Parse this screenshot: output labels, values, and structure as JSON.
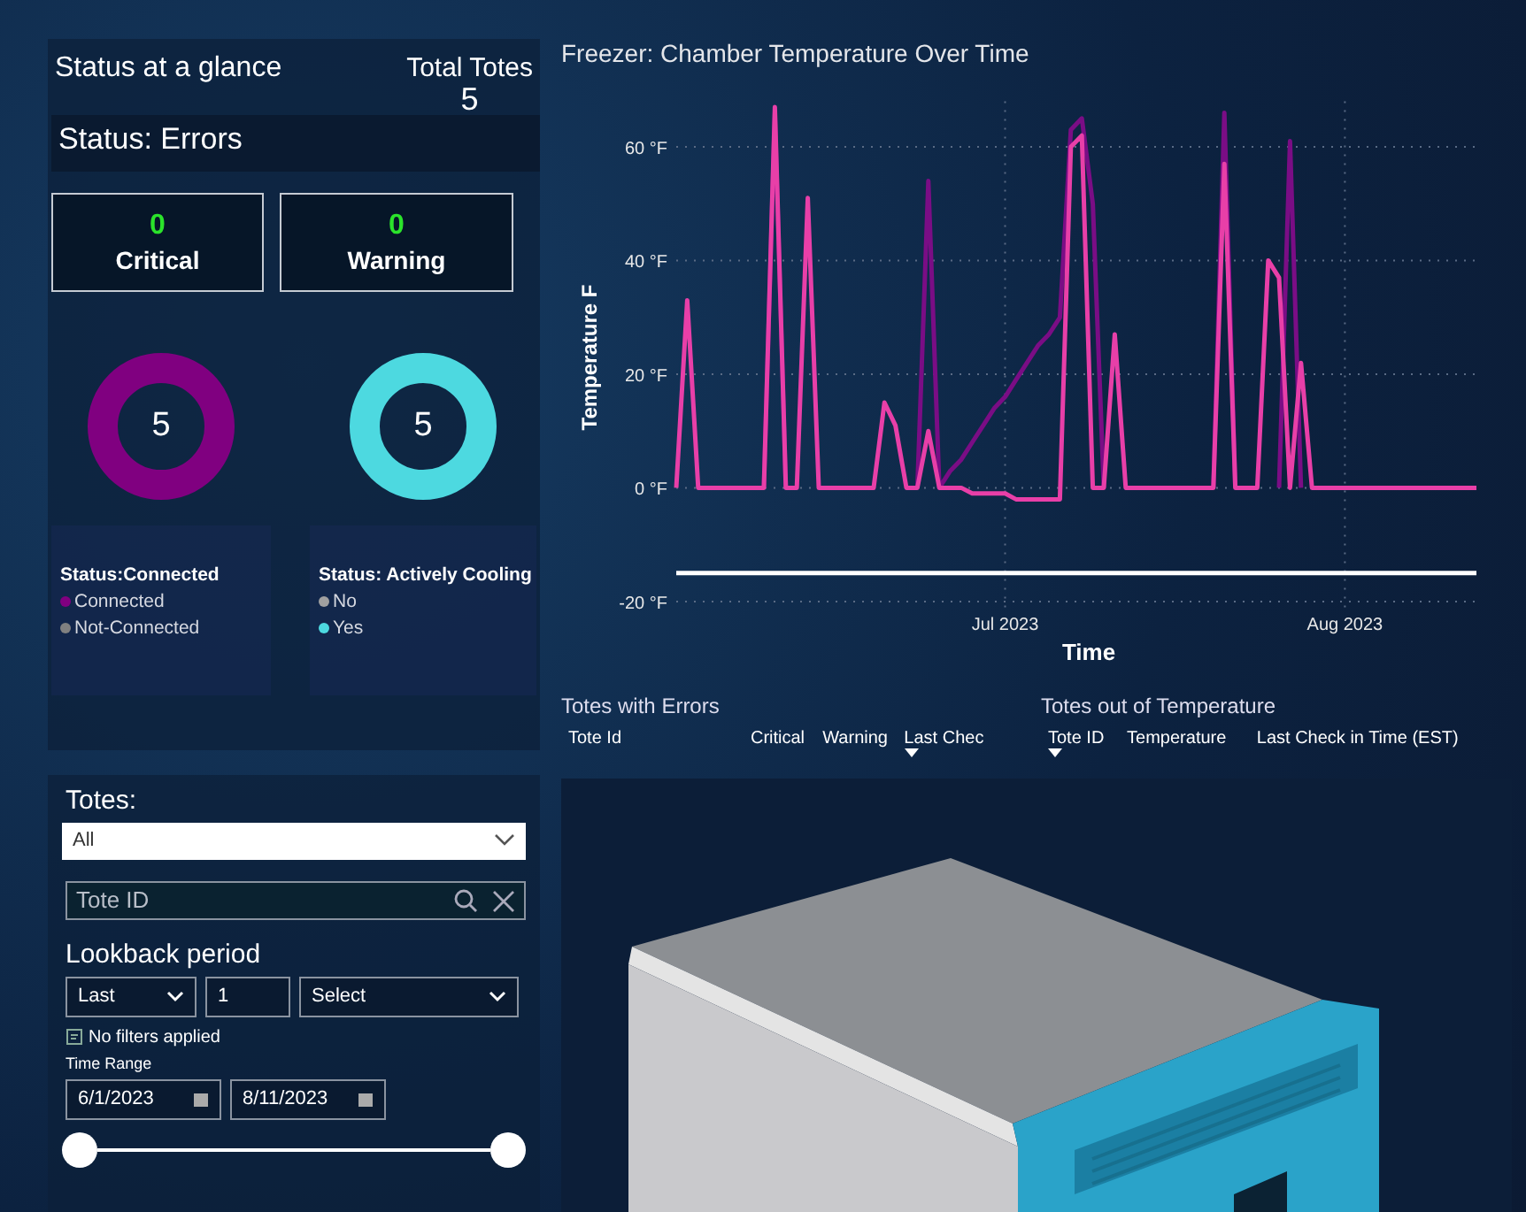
{
  "status_panel": {
    "title": "Status at a glance",
    "total_label": "Total Totes",
    "total_value": "5",
    "errors_title": "Status: Errors",
    "error_cards": [
      {
        "value": "0",
        "label": "Critical"
      },
      {
        "value": "0",
        "label": "Warning"
      }
    ],
    "donuts": [
      {
        "value": "5",
        "color": "#800080",
        "legend_title": "Status:Connected",
        "legend": [
          {
            "label": "Connected",
            "color": "#800080"
          },
          {
            "label": "Not-Connected",
            "color": "#808080"
          }
        ]
      },
      {
        "value": "5",
        "color": "#4dd9e0",
        "legend_title": "Status: Actively Cooling",
        "legend": [
          {
            "label": "No",
            "color": "#a0a0a0"
          },
          {
            "label": "Yes",
            "color": "#4dd9e0"
          }
        ]
      }
    ]
  },
  "filters": {
    "totes_label": "Totes:",
    "totes_dropdown": "All",
    "search": {
      "placeholder": "Tote ID"
    },
    "lookback_title": "Lookback period",
    "lookback": {
      "mode": "Last",
      "count": "1",
      "unit": "Select"
    },
    "filter_note": "No filters applied",
    "time_range_label": "Time Range",
    "start_date": "6/1/2023",
    "end_date": "8/11/2023",
    "range_thumbs": [
      {
        "level": 0
      },
      {
        "level": 1
      }
    ]
  },
  "chart": {
    "chart_data": {
      "type": "line",
      "title": "Freezer: Chamber Temperature Over Time",
      "xlabel": "Time",
      "ylabel": "Temperature F",
      "ylim": [
        -22,
        68
      ],
      "categories": [
        null,
        null,
        null,
        null,
        null,
        null,
        null,
        null,
        null,
        null,
        null,
        null,
        null,
        null,
        null,
        null,
        null,
        null,
        null,
        null,
        null,
        null,
        null,
        null,
        null,
        null,
        null,
        null,
        null,
        null,
        "Jul 2023",
        null,
        null,
        null,
        null,
        null,
        null,
        null,
        null,
        null,
        null,
        null,
        null,
        null,
        null,
        null,
        null,
        null,
        null,
        null,
        null,
        null,
        null,
        null,
        null,
        null,
        null,
        null,
        null,
        null,
        null,
        "Aug 2023",
        null,
        null,
        null,
        null,
        null,
        null,
        null,
        null,
        null,
        null,
        null,
        null
      ],
      "yticks": [
        {
          "value": -20,
          "label": "-20 °F"
        },
        {
          "value": 0,
          "label": "0 °F"
        },
        {
          "value": 20,
          "label": "20 °F"
        },
        {
          "value": 40,
          "label": "40 °F"
        },
        {
          "value": 60,
          "label": "60 °F"
        }
      ],
      "grid": true,
      "series": [
        {
          "color": "#7a0d85",
          "values": [
            null,
            null,
            null,
            null,
            null,
            null,
            null,
            null,
            0,
            66,
            0,
            null,
            null,
            null,
            null,
            null,
            null,
            null,
            null,
            null,
            null,
            null,
            0,
            54,
            0,
            3,
            5,
            8,
            11,
            14,
            16,
            19,
            22,
            25,
            27,
            30,
            63,
            65,
            50,
            0,
            null,
            null,
            null,
            null,
            null,
            null,
            null,
            null,
            null,
            0,
            66,
            0,
            null,
            null,
            null,
            0,
            61,
            0,
            null,
            null,
            null,
            null,
            null,
            null,
            null,
            null,
            null,
            null,
            null,
            null,
            null,
            null,
            null,
            null
          ]
        },
        {
          "color": "#e83fa8",
          "values": [
            0,
            33,
            0,
            0,
            0,
            0,
            0,
            0,
            0,
            67,
            0,
            0,
            51,
            0,
            0,
            0,
            0,
            0,
            0,
            15,
            11,
            0,
            0,
            10,
            0,
            0,
            0,
            -1,
            -1,
            -1,
            -1,
            -2,
            -2,
            -2,
            -2,
            -2,
            60,
            62,
            0,
            0,
            27,
            0,
            0,
            0,
            0,
            0,
            0,
            0,
            0,
            0,
            57,
            0,
            0,
            0,
            40,
            37,
            0,
            22,
            0,
            0,
            0,
            0,
            0,
            0,
            0,
            0,
            0,
            0,
            0,
            0,
            0,
            0,
            0,
            0
          ]
        },
        {
          "color": "#ffffff",
          "values": [
            -15,
            -15,
            -15,
            -15,
            -15,
            -15,
            -15,
            -15,
            -15,
            -15,
            -15,
            -15,
            -15,
            -15,
            -15,
            -15,
            -15,
            -15,
            -15,
            -15,
            -15,
            -15,
            -15,
            -15,
            -15,
            -15,
            -15,
            -15,
            -15,
            -15,
            -15,
            -15,
            -15,
            -15,
            -15,
            -15,
            -15,
            -15,
            -15,
            -15,
            -15,
            -15,
            -15,
            -15,
            -15,
            -15,
            -15,
            -15,
            -15,
            -15,
            -15,
            -15,
            -15,
            -15,
            -15,
            -15,
            -15,
            -15,
            -15,
            -15,
            -15,
            -15,
            -15,
            -15,
            -15,
            -15,
            -15,
            -15,
            -15,
            -15,
            -15,
            -15,
            -15,
            -15
          ]
        }
      ]
    }
  },
  "tables": [
    {
      "title": "Totes with Errors",
      "columns": [
        {
          "label": "Tote Id",
          "sorted": false
        },
        {
          "label": "Critical",
          "sorted": false
        },
        {
          "label": "Warning",
          "sorted": false
        },
        {
          "label": "Last Chec",
          "sorted": true
        }
      ]
    },
    {
      "title": "Totes out of Temperature",
      "columns": [
        {
          "label": "Tote ID",
          "sorted": true
        },
        {
          "label": "Temperature",
          "sorted": false
        },
        {
          "label": "Last Check in Time (EST)",
          "sorted": false
        }
      ]
    }
  ]
}
